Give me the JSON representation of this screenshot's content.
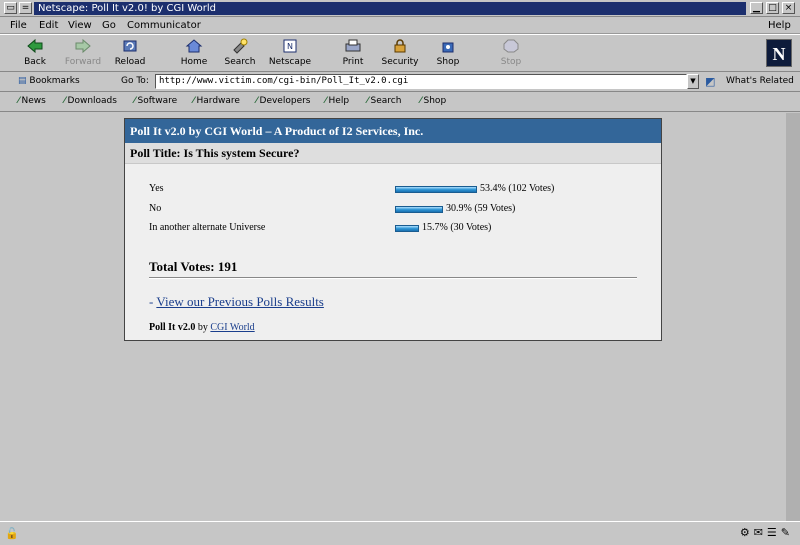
{
  "window": {
    "title": "Netscape: Poll It v2.0! by CGI World"
  },
  "menu": [
    "File",
    "Edit",
    "View",
    "Go",
    "Communicator",
    "Help"
  ],
  "toolbar": {
    "buttons": [
      "Back",
      "Forward",
      "Reload",
      "Home",
      "Search",
      "Netscape",
      "Print",
      "Security",
      "Shop",
      "Stop"
    ]
  },
  "location": {
    "bookmarks_label": "Bookmarks",
    "goto_label": "Go To:",
    "url": "http://www.victim.com/cgi-bin/Poll_It_v2.0.cgi",
    "related_label": "What's Related"
  },
  "personal_bar": [
    "News",
    "Downloads",
    "Software",
    "Hardware",
    "Developers",
    "Help",
    "Search",
    "Shop"
  ],
  "poll": {
    "header": "Poll It v2.0 by CGI World – A Product of I2 Services, Inc.",
    "title": "Poll Title: Is This system Secure?",
    "options": [
      {
        "label": "Yes",
        "result": "53.4% (102 Votes)",
        "percent": 53.4
      },
      {
        "label": "No",
        "result": "30.9% (59 Votes)",
        "percent": 30.9
      },
      {
        "label": "In another alternate Universe",
        "result": "15.7% (30 Votes)",
        "percent": 15.7
      }
    ],
    "total": "Total Votes: 191",
    "previous_prefix": "- ",
    "previous_link": "View our Previous Polls Results",
    "credit_prefix": "Poll It v2.0",
    "credit_by": " by ",
    "credit_link": "CGI World"
  }
}
